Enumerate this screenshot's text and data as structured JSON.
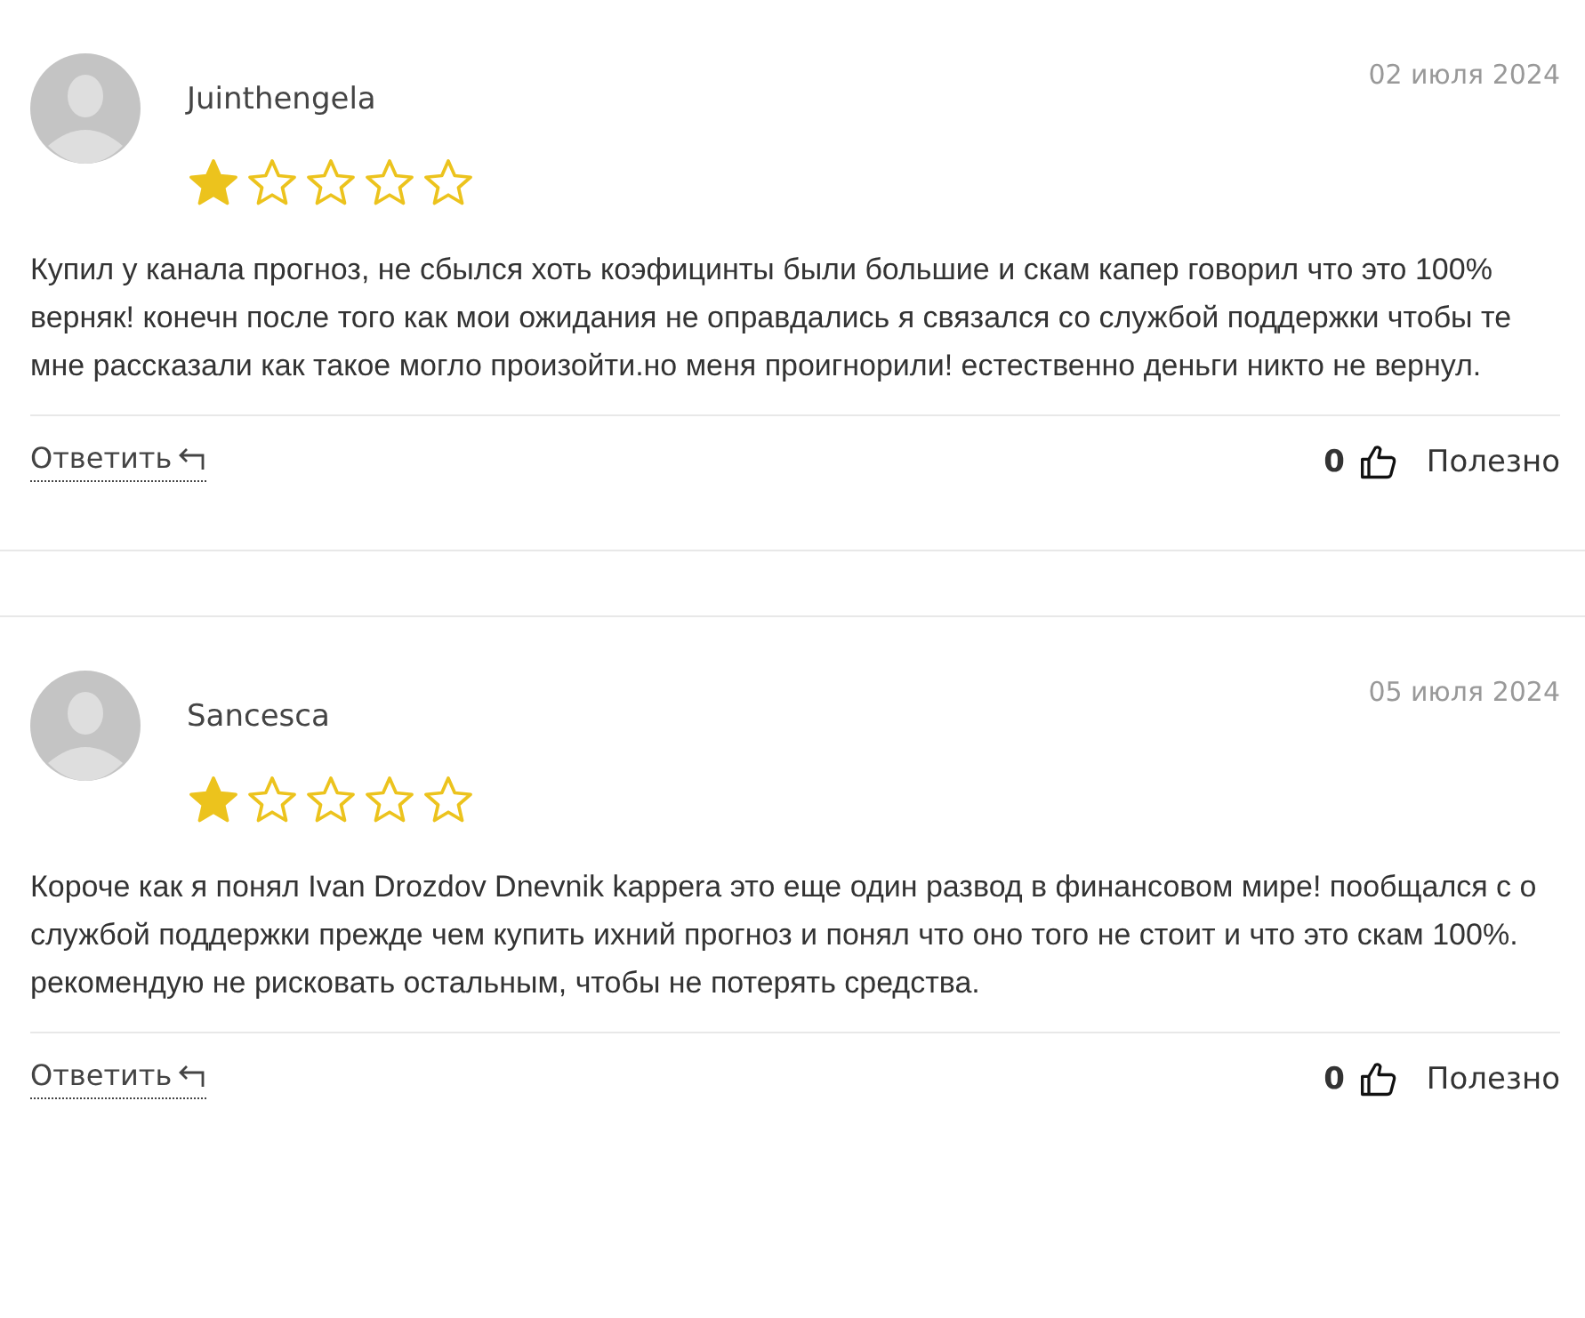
{
  "reviews": [
    {
      "author": "Juinthengela",
      "date": "02 июля 2024",
      "stars": 1,
      "text": "Купил у канала прогноз, не сбылся хоть коэфицинты были большие и скам капер говорил что это 100% верняк! конечн после того как мои ожидания не оправдались я связался со службой поддержки чтобы те мне рассказали как такое могло произойти.но меня проигнорили! естественно деньги никто не вернул.",
      "reply": "Ответить",
      "likes": "0",
      "helpful": "Полезно"
    },
    {
      "author": "Sancesca",
      "date": "05 июля 2024",
      "stars": 1,
      "text": "Короче как я понял Ivan Drozdov Dnevnik kappera это еще один развод в финансовом мире! пообщался с о службой поддержки прежде чем купить ихний прогноз и понял что оно того не стоит и что это скам 100%. рекомендую не рисковать остальным, чтобы не потерять средства.",
      "reply": "Ответить",
      "likes": "0",
      "helpful": "Полезно"
    }
  ]
}
